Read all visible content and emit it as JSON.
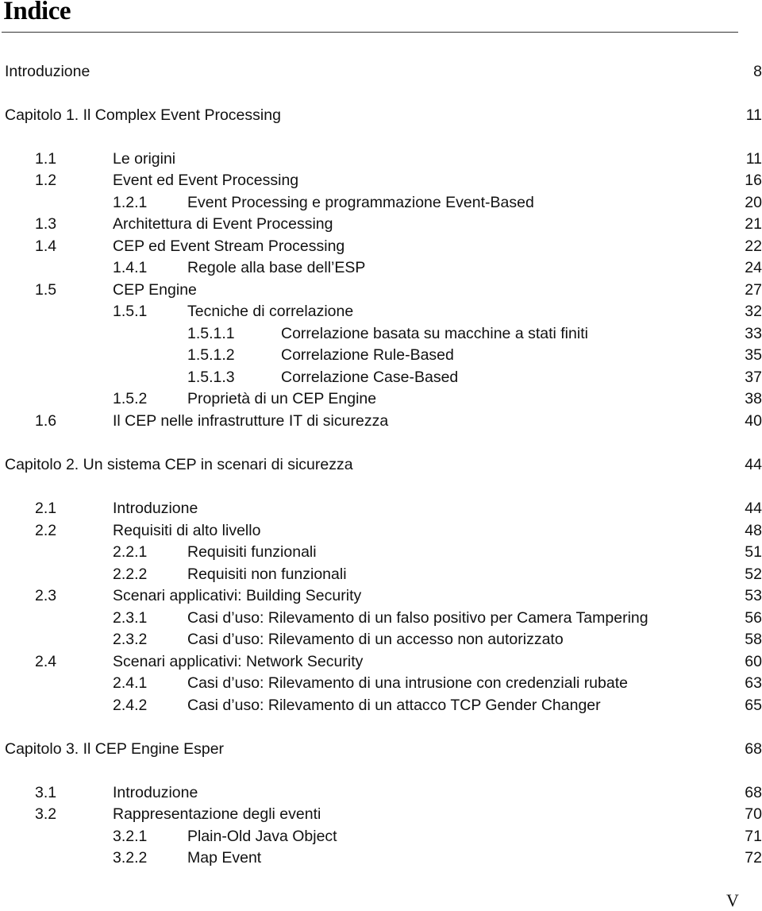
{
  "page": {
    "title": "Indice",
    "folio": "V"
  },
  "toc": [
    {
      "level": 0,
      "number": "",
      "title": "Introduzione",
      "page": "8"
    },
    {
      "level": 0,
      "number": "",
      "title": "Capitolo 1. Il Complex Event Processing",
      "page": "11"
    },
    {
      "level": 1,
      "number": "1.1",
      "title": "Le origini",
      "page": "11"
    },
    {
      "level": 1,
      "number": "1.2",
      "title": "Event ed Event Processing",
      "page": "16"
    },
    {
      "level": 2,
      "number": "1.2.1",
      "title": "Event Processing e programmazione Event-Based",
      "page": "20"
    },
    {
      "level": 1,
      "number": "1.3",
      "title": "Architettura di Event Processing",
      "page": "21"
    },
    {
      "level": 1,
      "number": "1.4",
      "title": "CEP ed Event Stream Processing",
      "page": "22"
    },
    {
      "level": 2,
      "number": "1.4.1",
      "title": "Regole alla base dell’ESP",
      "page": "24"
    },
    {
      "level": 1,
      "number": "1.5",
      "title": "CEP Engine",
      "page": "27"
    },
    {
      "level": 2,
      "number": "1.5.1",
      "title": "Tecniche di correlazione",
      "page": "32"
    },
    {
      "level": 3,
      "number": "1.5.1.1",
      "title": "Correlazione basata su macchine a stati finiti",
      "page": "33"
    },
    {
      "level": 3,
      "number": "1.5.1.2",
      "title": "Correlazione Rule-Based",
      "page": "35"
    },
    {
      "level": 3,
      "number": "1.5.1.3",
      "title": "Correlazione Case-Based",
      "page": "37"
    },
    {
      "level": 2,
      "number": "1.5.2",
      "title": "Proprietà di un CEP Engine",
      "page": "38"
    },
    {
      "level": 1,
      "number": "1.6",
      "title": "Il CEP nelle infrastrutture IT di sicurezza",
      "page": "40"
    },
    {
      "level": 0,
      "number": "",
      "title": "Capitolo 2. Un sistema CEP in scenari di sicurezza",
      "page": "44"
    },
    {
      "level": 1,
      "number": "2.1",
      "title": "Introduzione",
      "page": "44"
    },
    {
      "level": 1,
      "number": "2.2",
      "title": "Requisiti di alto livello",
      "page": "48"
    },
    {
      "level": 2,
      "number": "2.2.1",
      "title": "Requisiti funzionali",
      "page": "51"
    },
    {
      "level": 2,
      "number": "2.2.2",
      "title": "Requisiti non funzionali",
      "page": "52"
    },
    {
      "level": 1,
      "number": "2.3",
      "title": "Scenari applicativi: Building Security",
      "page": "53"
    },
    {
      "level": 2,
      "number": "2.3.1",
      "title": "Casi d’uso: Rilevamento di un falso positivo per Camera Tampering",
      "page": "56"
    },
    {
      "level": 2,
      "number": "2.3.2",
      "title": "Casi d’uso: Rilevamento di un accesso non autorizzato",
      "page": "58"
    },
    {
      "level": 1,
      "number": "2.4",
      "title": "Scenari applicativi: Network Security",
      "page": "60"
    },
    {
      "level": 2,
      "number": "2.4.1",
      "title": "Casi d’uso: Rilevamento di una intrusione con credenziali rubate",
      "page": "63"
    },
    {
      "level": 2,
      "number": "2.4.2",
      "title": "Casi d’uso: Rilevamento di un attacco TCP Gender Changer",
      "page": "65"
    },
    {
      "level": 0,
      "number": "",
      "title": "Capitolo 3. Il CEP Engine Esper",
      "page": "68"
    },
    {
      "level": 1,
      "number": "3.1",
      "title": "Introduzione",
      "page": "68"
    },
    {
      "level": 1,
      "number": "3.2",
      "title": "Rappresentazione degli eventi",
      "page": "70"
    },
    {
      "level": 2,
      "number": "3.2.1",
      "title": "Plain-Old Java Object",
      "page": "71"
    },
    {
      "level": 2,
      "number": "3.2.2",
      "title": "Map Event",
      "page": "72"
    }
  ]
}
